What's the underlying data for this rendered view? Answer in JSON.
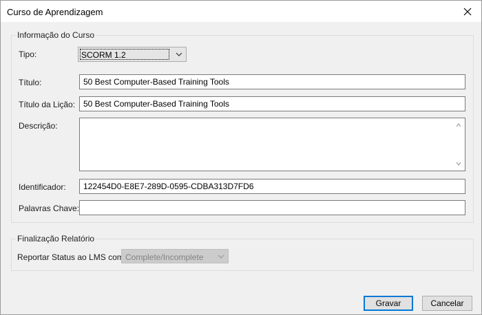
{
  "window": {
    "title": "Curso de Aprendizagem"
  },
  "course_info": {
    "legend": "Informação do Curso",
    "tipo_label": "Tipo:",
    "tipo_value": "SCORM 1.2",
    "titulo_label": "Título:",
    "titulo_value": "50 Best Computer-Based Training Tools",
    "titulo_licao_label": "Título da Lição:",
    "titulo_licao_value": "50 Best Computer-Based Training Tools",
    "descricao_label": "Descrição:",
    "descricao_value": "",
    "identificador_label": "Identificador:",
    "identificador_value": "122454D0-E8E7-289D-0595-CDBA313D7FD6",
    "palavras_label": "Palavras Chave:",
    "palavras_value": ""
  },
  "report": {
    "legend": "Finalização Relatório",
    "status_label": "Reportar Status ao LMS como:",
    "status_value": "Complete/Incomplete"
  },
  "buttons": {
    "save": "Gravar",
    "cancel": "Cancelar"
  },
  "icons": {
    "close": "close-icon",
    "dropdown": "chevron-down-icon",
    "scroll_up": "chevron-up-icon",
    "scroll_down": "chevron-down-icon"
  }
}
